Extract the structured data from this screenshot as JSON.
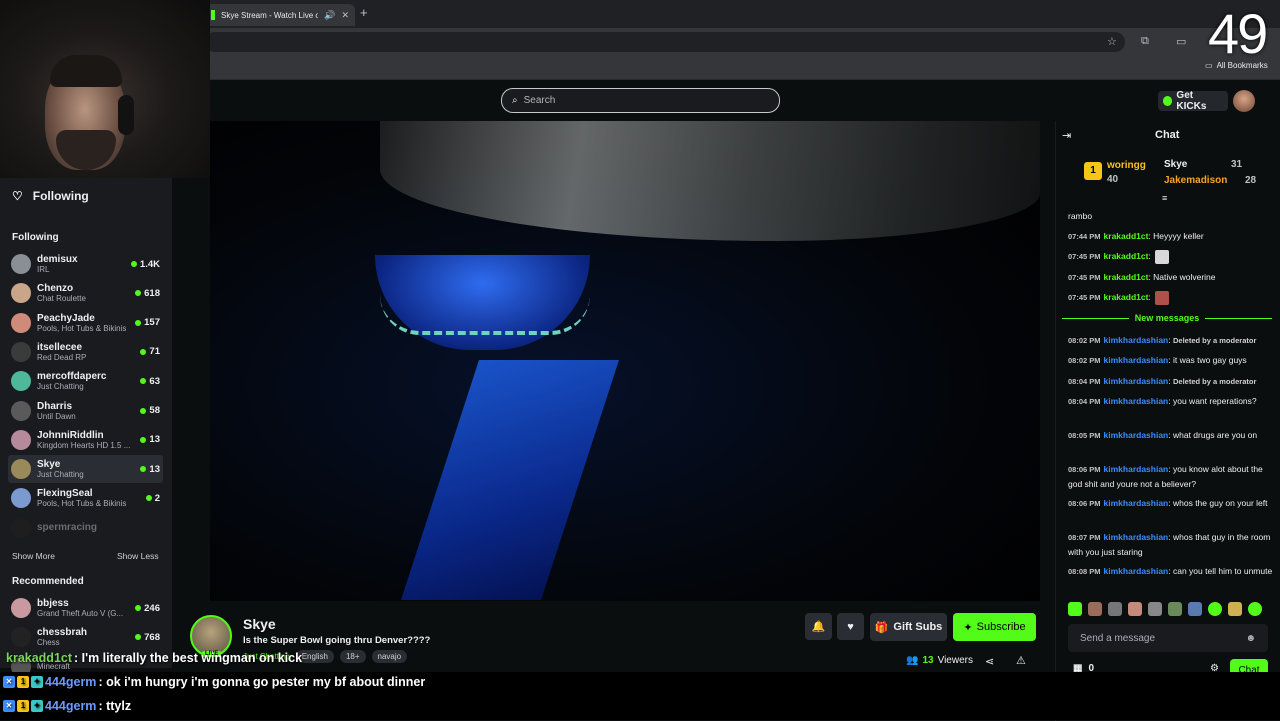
{
  "browser": {
    "tab_title": "Skye Stream - Watch Live o",
    "new_tab": "+",
    "bookmarks_label": "All Bookmarks"
  },
  "header": {
    "search_placeholder": "Search",
    "get_kicks": "Get KICKs"
  },
  "sidebar": {
    "following_header": "Following",
    "following_title": "Following",
    "following": [
      {
        "name": "demisux",
        "category": "IRL",
        "viewers": "1.4K",
        "avatar_color": "#8a8f96",
        "live": true,
        "active": false
      },
      {
        "name": "Chenzo",
        "category": "Chat Roulette",
        "viewers": "618",
        "avatar_color": "#c9a58a",
        "live": true,
        "active": false
      },
      {
        "name": "PeachyJade",
        "category": "Pools, Hot Tubs & Bikinis",
        "viewers": "157",
        "avatar_color": "#d08a7a",
        "live": true,
        "active": false
      },
      {
        "name": "itsellecee",
        "category": "Red Dead RP",
        "viewers": "71",
        "avatar_color": "#3b3b3b",
        "live": true,
        "active": false
      },
      {
        "name": "mercoffdaperc",
        "category": "Just Chatting",
        "viewers": "63",
        "avatar_color": "#4fb89a",
        "live": true,
        "active": false
      },
      {
        "name": "Dharris",
        "category": "Until Dawn",
        "viewers": "58",
        "avatar_color": "#5a5a5a",
        "live": true,
        "active": false
      },
      {
        "name": "JohnniRiddlin",
        "category": "Kingdom Hearts HD 1.5 ...",
        "viewers": "13",
        "avatar_color": "#b58a9a",
        "live": true,
        "active": false
      },
      {
        "name": "Skye",
        "category": "Just Chatting",
        "viewers": "13",
        "avatar_color": "#9a8a5a",
        "live": true,
        "active": true
      },
      {
        "name": "FlexingSeal",
        "category": "Pools, Hot Tubs & Bikinis",
        "viewers": "2",
        "avatar_color": "#7a9ad0",
        "live": true,
        "active": false
      },
      {
        "name": "spermracing",
        "category": "",
        "viewers": "",
        "avatar_color": "#1e1e1e",
        "live": false,
        "active": false
      }
    ],
    "show_more": "Show More",
    "show_less": "Show Less",
    "recommended_title": "Recommended",
    "recommended": [
      {
        "name": "bbjess",
        "category": "Grand Theft Auto V (G...",
        "viewers": "246",
        "avatar_color": "#c89aa0"
      },
      {
        "name": "chessbrah",
        "category": "Chess",
        "viewers": "768",
        "avatar_color": "#222222"
      },
      {
        "name": "",
        "category": "Minecraft",
        "viewers": "",
        "avatar_color": "#555555"
      }
    ]
  },
  "stream": {
    "streamer_name": "Skye",
    "title": "Is the Super Bowl going thru Denver????",
    "live_badge": "LIVE",
    "category": "Just Chatting",
    "tags": [
      "English",
      "18+",
      "navajo"
    ],
    "gift_subs": "Gift Subs",
    "subscribe": "Subscribe",
    "viewers_count": "13",
    "viewers_label": "Viewers"
  },
  "chat": {
    "title": "Chat",
    "leaderboard": {
      "rank1_name": "woringg",
      "rank1_count": "40",
      "rank2_name": "Skye",
      "rank2_count": "31",
      "rank3_name": "Jakemadison",
      "rank3_count": "28"
    },
    "messages_before": [
      {
        "time": "",
        "user": "",
        "text": "rambo",
        "user_color": "#53fc18"
      },
      {
        "time": "07:44 PM",
        "user": "krakadd1ct",
        "text": ": Heyyyy keller",
        "user_color": "#53fc18"
      },
      {
        "time": "07:45 PM",
        "user": "krakadd1ct",
        "text": ":",
        "user_color": "#53fc18",
        "emote": "#d8d8d8"
      },
      {
        "time": "07:45 PM",
        "user": "krakadd1ct",
        "text": ": Native wolverine",
        "user_color": "#53fc18"
      },
      {
        "time": "07:45 PM",
        "user": "krakadd1ct",
        "text": ":",
        "user_color": "#53fc18",
        "emote": "#b0504a"
      }
    ],
    "new_messages_label": "New messages",
    "messages_after": [
      {
        "time": "08:02 PM",
        "user": "kimkhardashian",
        "text": ": ",
        "deleted": "Deleted by a moderator"
      },
      {
        "time": "08:02 PM",
        "user": "kimkhardashian",
        "text": ": it was two gay guys"
      },
      {
        "time": "08:04 PM",
        "user": "kimkhardashian",
        "text": ": ",
        "deleted": "Deleted by a moderator"
      },
      {
        "time": "08:04 PM",
        "user": "kimkhardashian",
        "text": ": you want reperations?"
      },
      {
        "time": "08:05 PM",
        "user": "kimkhardashian",
        "text": ": what drugs are you on"
      },
      {
        "time": "08:06 PM",
        "user": "kimkhardashian",
        "text": ": you know alot about the god shit and youre not a believer?"
      },
      {
        "time": "08:06 PM",
        "user": "kimkhardashian",
        "text": ": whos the guy on your left"
      },
      {
        "time": "08:07 PM",
        "user": "kimkhardashian",
        "text": ": whos that guy in the room with you just staring"
      },
      {
        "time": "08:08 PM",
        "user": "kimkhardashian",
        "text": ": can you tell him to unmute"
      }
    ],
    "input_placeholder": "Send a message",
    "points": "0",
    "send_label": "Chat"
  },
  "overlay": {
    "timer": "49",
    "lines": [
      {
        "user": "krakadd1ct",
        "text": " : I'm literally the best wingman on kick",
        "badges": false
      },
      {
        "user": "444germ",
        "text": " : ok i'm hungry i'm gonna go pester my bf about dinner",
        "badges": true
      },
      {
        "user": "444germ",
        "text": " : ttylz",
        "badges": true
      }
    ]
  },
  "colors": {
    "accent": "#53fc18",
    "chat_user_blue": "#3b8dff",
    "background": "#0b0e0f",
    "sidebar": "#191b1f"
  }
}
